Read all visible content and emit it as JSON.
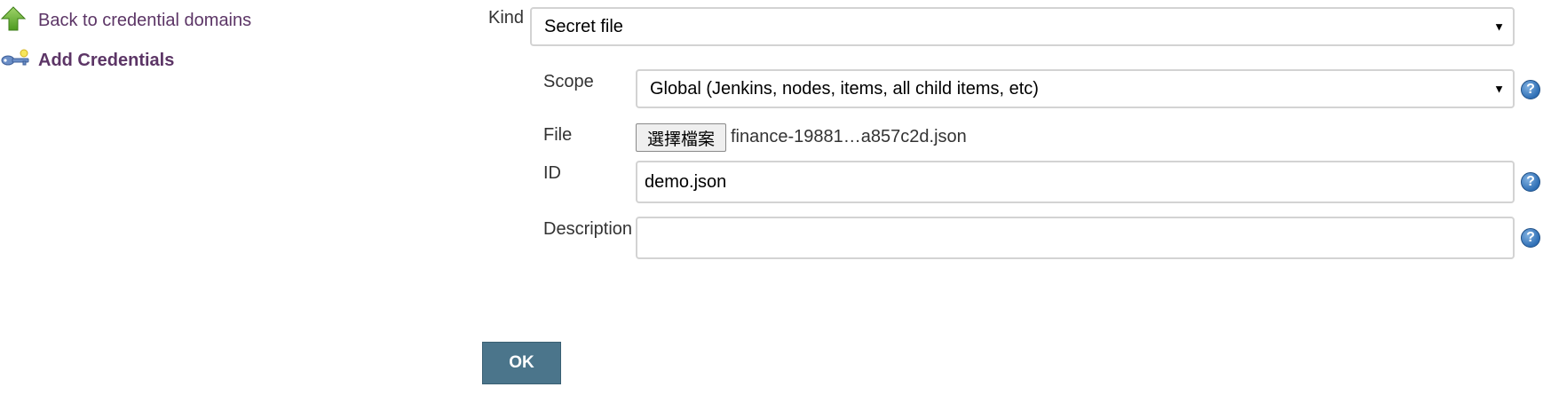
{
  "sidebar": {
    "back_label": "Back to credential domains",
    "add_label": "Add Credentials"
  },
  "form": {
    "kind": {
      "label": "Kind",
      "value": "Secret file"
    },
    "scope": {
      "label": "Scope",
      "value": "Global (Jenkins, nodes, items, all child items, etc)"
    },
    "file": {
      "label": "File",
      "button_label": "選擇檔案",
      "file_name": "finance-19881…a857c2d.json"
    },
    "id": {
      "label": "ID",
      "value": "demo.json"
    },
    "description": {
      "label": "Description",
      "value": ""
    },
    "help_glyph": "?"
  },
  "actions": {
    "ok_label": "OK"
  },
  "colors": {
    "link": "#5c3566",
    "ok_button": "#4b758b",
    "help_icon": "#2f6fb5",
    "arrow_icon": "#5aa02c"
  }
}
